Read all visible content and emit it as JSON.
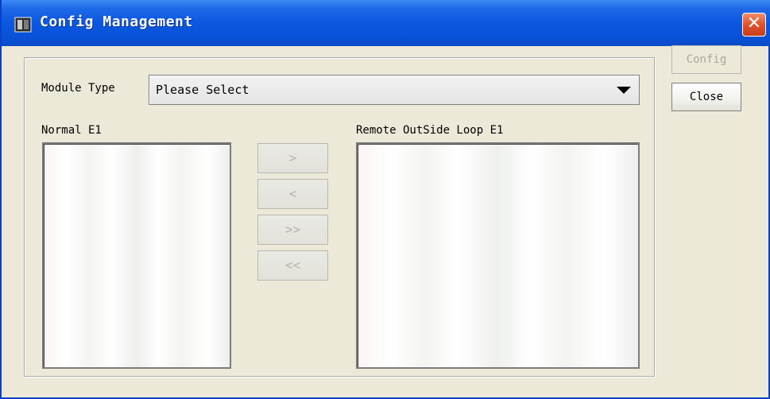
{
  "window": {
    "title": "Config Management",
    "close_glyph": "✕",
    "icon": "app-window-icon"
  },
  "form": {
    "module_type_label": "Module Type",
    "module_type_value": "Please Select",
    "normal_label": "Normal E1",
    "remote_label": "Remote OutSide Loop E1"
  },
  "move_buttons": {
    "move_right": ">",
    "move_left": "<",
    "move_all_right": ">>",
    "move_all_left": "<<"
  },
  "side_buttons": {
    "config": "Config",
    "close": "Close"
  },
  "colors": {
    "titlebar": "#0a58e0",
    "close_button": "#e0512c",
    "dialog_bg": "#ece9d8"
  }
}
